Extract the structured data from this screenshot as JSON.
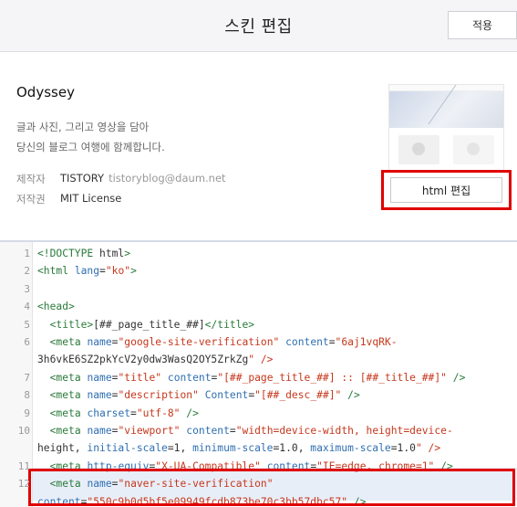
{
  "header": {
    "title": "스킨 편집",
    "apply_label": "적용"
  },
  "skin": {
    "name": "Odyssey",
    "description_line1": "글과 사진, 그리고 영상을 담아",
    "description_line2": "당신의 블로그 여행에 함께합니다.",
    "author_key": "제작자",
    "author_name": "TISTORY",
    "author_email": "tistoryblog@daum.net",
    "license_key": "저작권",
    "license_value": "MIT License",
    "html_edit_label": "html 편집"
  },
  "editor": {
    "lines": [
      {
        "n": "1",
        "code": "<!DOCTYPE html>"
      },
      {
        "n": "2",
        "code": "<html lang=\"ko\">"
      },
      {
        "n": "3",
        "code": ""
      },
      {
        "n": "4",
        "code": "<head>"
      },
      {
        "n": "5",
        "code": "  <title>[##_page_title_##]</title>"
      },
      {
        "n": "6",
        "code": "  <meta name=\"google-site-verification\" content=\"6aj1vqRK-"
      },
      {
        "n": "",
        "code": "3h6vkE6SZ2pkYcV2y0dw3WasQ2OY5ZrkZg\" />"
      },
      {
        "n": "7",
        "code": "  <meta name=\"title\" content=\"[##_page_title_##] :: [##_title_##]\" />"
      },
      {
        "n": "8",
        "code": "  <meta name=\"description\" Content=\"[##_desc_##]\" />"
      },
      {
        "n": "9",
        "code": "  <meta charset=\"utf-8\" />"
      },
      {
        "n": "10",
        "code": "  <meta name=\"viewport\" content=\"width=device-width, height=device-"
      },
      {
        "n": "",
        "code": "height, initial-scale=1, minimum-scale=1.0, maximum-scale=1.0\" />"
      },
      {
        "n": "11",
        "code": "  <meta http-equiv=\"X-UA-Compatible\" content=\"IE=edge, chrome=1\" />"
      },
      {
        "n": "12",
        "code": "  <meta name=\"naver-site-verification\""
      },
      {
        "n": "",
        "code": "content=\"550c9b0d5bf5e09949fcdb873be70c3bb57dbc57\" />"
      }
    ],
    "highlighted_line": "12"
  },
  "colors": {
    "highlight_border": "#e00000",
    "tag": "#2a7a3a",
    "attr": "#2f6fb0",
    "string": "#c6371c"
  }
}
